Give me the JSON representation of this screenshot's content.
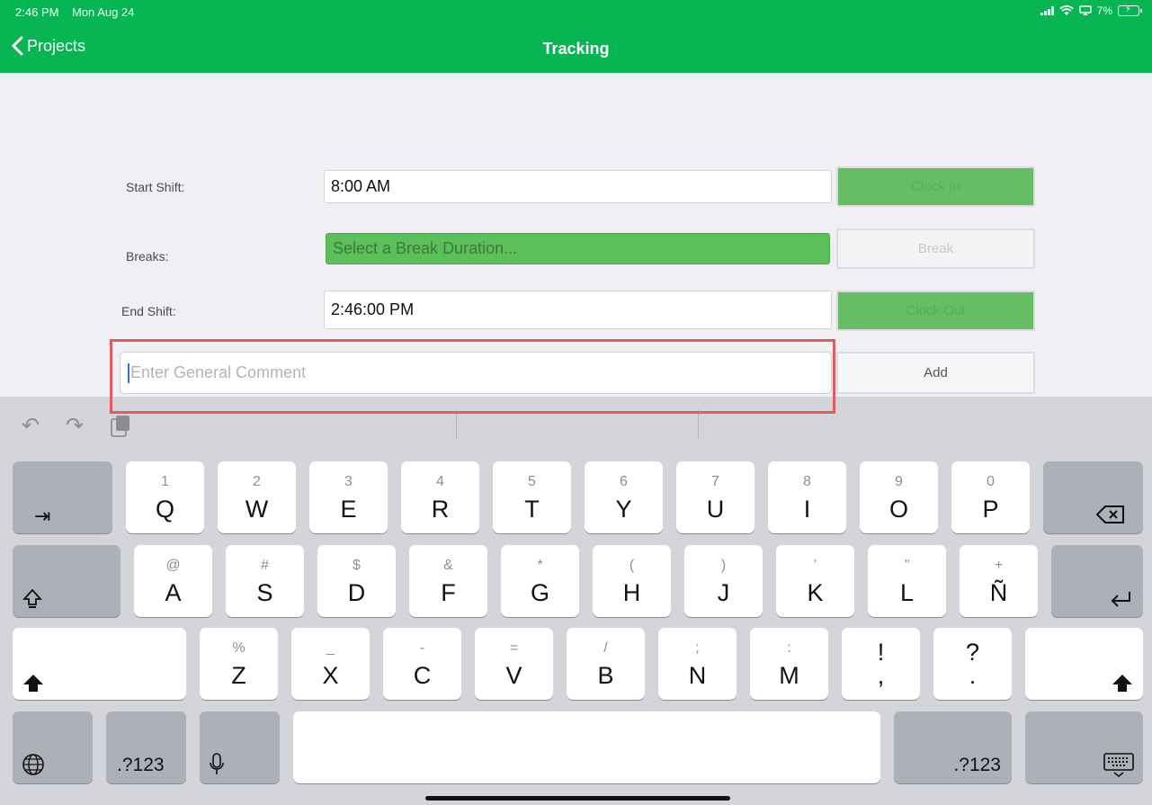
{
  "status_bar": {
    "time": "2:46 PM",
    "date": "Mon Aug 24",
    "battery": "7%"
  },
  "nav": {
    "back_label": "Projects",
    "title": "Tracking"
  },
  "form": {
    "start_shift": {
      "label": "Start Shift:",
      "value": "8:00 AM",
      "button": "Clock In"
    },
    "breaks": {
      "label": "Breaks:",
      "placeholder": "Select a Break Duration...",
      "button": "Break"
    },
    "end_shift": {
      "label": "End Shift:",
      "value": "2:46:00 PM",
      "button": "Clock Out"
    },
    "comment": {
      "placeholder": "Enter General Comment",
      "button": "Add"
    }
  },
  "colors": {
    "nav": "#07b552",
    "accent_green": "#5cbf5a",
    "highlight": "#e05c5f"
  },
  "keyboard": {
    "row1": [
      {
        "k": "Q",
        "s": "1"
      },
      {
        "k": "W",
        "s": "2"
      },
      {
        "k": "E",
        "s": "3"
      },
      {
        "k": "R",
        "s": "4"
      },
      {
        "k": "T",
        "s": "5"
      },
      {
        "k": "Y",
        "s": "6"
      },
      {
        "k": "U",
        "s": "7"
      },
      {
        "k": "I",
        "s": "8"
      },
      {
        "k": "O",
        "s": "9"
      },
      {
        "k": "P",
        "s": "0"
      }
    ],
    "row2": [
      {
        "k": "A",
        "s": "@"
      },
      {
        "k": "S",
        "s": "#"
      },
      {
        "k": "D",
        "s": "$"
      },
      {
        "k": "F",
        "s": "&"
      },
      {
        "k": "G",
        "s": "*"
      },
      {
        "k": "H",
        "s": "("
      },
      {
        "k": "J",
        "s": ")"
      },
      {
        "k": "K",
        "s": "’"
      },
      {
        "k": "L",
        "s": "”"
      },
      {
        "k": "Ñ",
        "s": "+"
      }
    ],
    "row3": [
      {
        "k": "Z",
        "s": "%"
      },
      {
        "k": "X",
        "s": "_"
      },
      {
        "k": "C",
        "s": "-"
      },
      {
        "k": "V",
        "s": "="
      },
      {
        "k": "B",
        "s": "/"
      },
      {
        "k": "N",
        "s": ";"
      },
      {
        "k": "M",
        "s": ":"
      }
    ],
    "punct": [
      {
        "top": "!",
        "bottom": ","
      },
      {
        "top": "?",
        "bottom": "."
      }
    ],
    "numbers_label": ".?123"
  }
}
